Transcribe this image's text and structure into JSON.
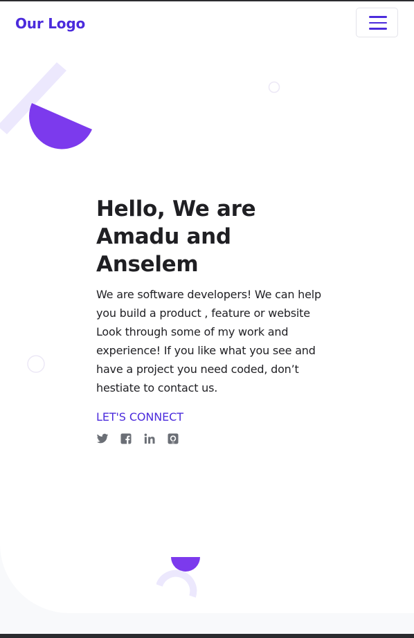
{
  "navbar": {
    "logo": "Our Logo"
  },
  "hero": {
    "headline": "Hello, We are Amadu and Anselem",
    "intro": "We are software developers! We can help you build a product , feature or website Look through some of my work and experience! If you like what you see and have a project you need coded, don’t hestiate to contact us.",
    "cta": "LET'S CONNECT"
  },
  "socials": [
    {
      "icon": "twitter-icon"
    },
    {
      "icon": "facebook-icon"
    },
    {
      "icon": "linkedin-icon"
    },
    {
      "icon": "github-icon"
    }
  ],
  "colors": {
    "accent": "#4b2bdc",
    "decor_purple": "#7c3aed",
    "decor_lavender": "#ece8fd",
    "text": "#1f1f23",
    "icon": "#6b6f76",
    "page_bg": "#f8f9fb"
  }
}
